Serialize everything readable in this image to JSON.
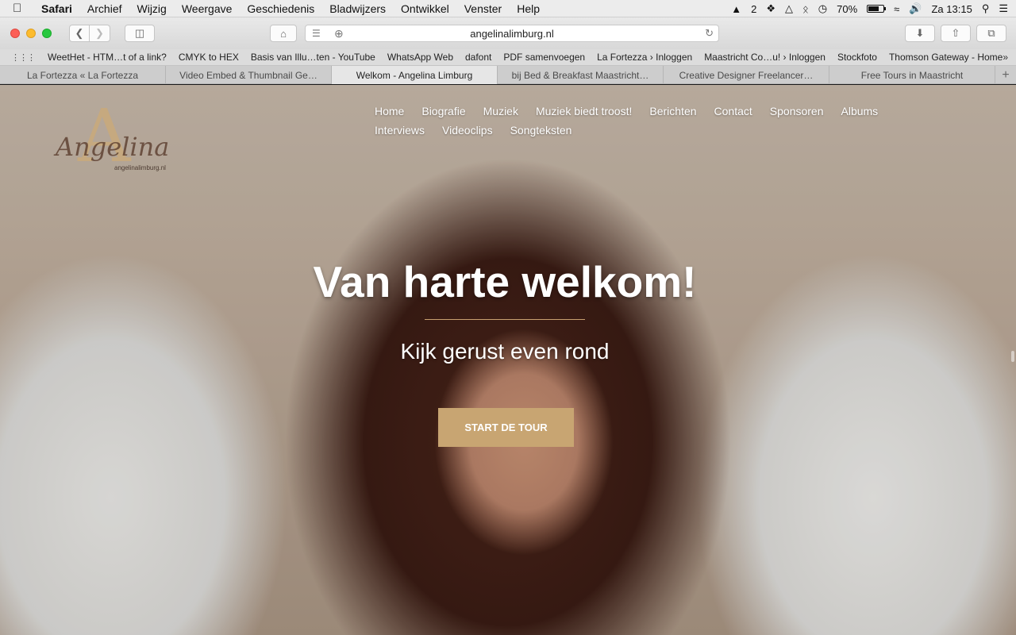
{
  "menubar": {
    "app": "Safari",
    "items": [
      "Archief",
      "Wijzig",
      "Weergave",
      "Geschiedenis",
      "Bladwijzers",
      "Ontwikkel",
      "Venster",
      "Help"
    ],
    "status": {
      "adobe_count": "2",
      "battery": "70%",
      "battery_level": 0.7,
      "clock": "Za 13:15"
    }
  },
  "toolbar": {
    "address": "angelinalimburg.nl"
  },
  "bookmarks": [
    "WeetHet - HTM…t of a link?",
    "CMYK to HEX",
    "Basis van Illu…ten - YouTube",
    "WhatsApp Web",
    "dafont",
    "PDF samenvoegen",
    "La Fortezza › Inloggen",
    "Maastricht Co…u! › Inloggen",
    "Stockfoto",
    "Thomson Gateway - Home"
  ],
  "tabs": [
    {
      "label": "La Fortezza « La Fortezza",
      "active": false
    },
    {
      "label": "Video Embed & Thumbnail Ge…",
      "active": false
    },
    {
      "label": "Welkom - Angelina Limburg",
      "active": true
    },
    {
      "label": "bij Bed & Breakfast Maastricht…",
      "active": false
    },
    {
      "label": "Creative Designer Freelancer…",
      "active": false
    },
    {
      "label": "Free Tours in Maastricht",
      "active": false
    }
  ],
  "page": {
    "logo": {
      "name": "Angelina",
      "url": "angelinalimburg.nl"
    },
    "nav_row1": [
      "Home",
      "Biografie",
      "Muziek",
      "Muziek biedt troost!",
      "Berichten",
      "Contact",
      "Sponsoren",
      "Albums"
    ],
    "nav_row2": [
      "Interviews",
      "Videoclips",
      "Songteksten"
    ],
    "headline": "Van harte welkom!",
    "subline": "Kijk gerust even rond",
    "cta": "START DE TOUR",
    "accent_color": "#c8a572"
  }
}
